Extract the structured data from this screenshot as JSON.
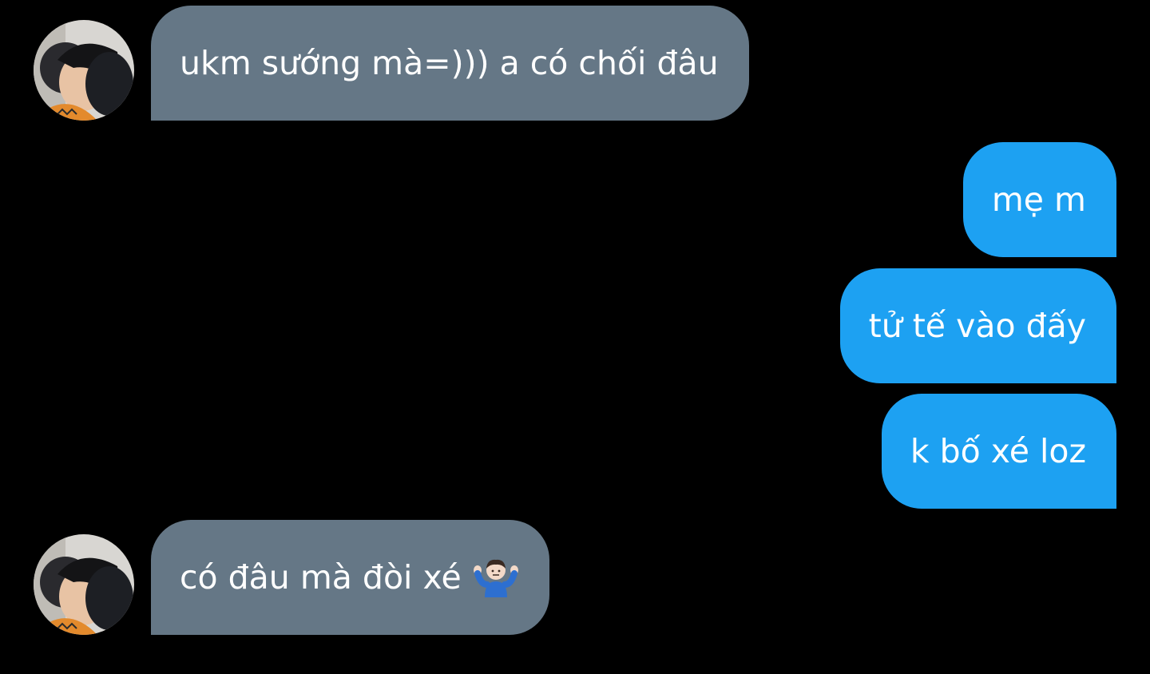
{
  "conversation": {
    "messages": [
      {
        "direction": "incoming",
        "text": "ukm sướng mà=))) a có chối đâu",
        "avatar": "contact-avatar-photo"
      },
      {
        "direction": "outgoing",
        "text": "mẹ m"
      },
      {
        "direction": "outgoing",
        "text": "tử tế vào đấy"
      },
      {
        "direction": "outgoing",
        "text": "k bố xé loz"
      },
      {
        "direction": "incoming",
        "text": "có đâu mà đòi xé",
        "emoji": "man-shrugging-emoji",
        "avatar": "contact-avatar-photo"
      }
    ]
  },
  "colors": {
    "background": "#000000",
    "incoming_bubble": "#657786",
    "outgoing_bubble": "#1da1f2",
    "text": "#ffffff"
  }
}
